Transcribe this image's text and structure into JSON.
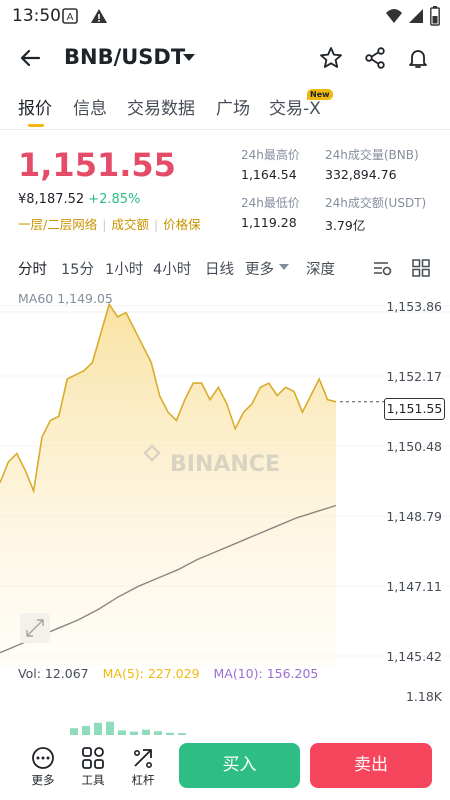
{
  "status_bar": {
    "time": "13:50",
    "battery": "battery"
  },
  "header": {
    "pair": "BNB/USDT"
  },
  "tabs": [
    {
      "label": "报价",
      "active": true
    },
    {
      "label": "信息"
    },
    {
      "label": "交易数据"
    },
    {
      "label": "广场"
    },
    {
      "label": "交易-X",
      "badge": "New"
    }
  ],
  "ticker": {
    "last_price": "1,151.55",
    "fiat_price": "¥8,187.52",
    "change_pct": "+2.85%",
    "tags": [
      "一层/二层网络",
      "成交额",
      "价格保"
    ],
    "stats": {
      "high_label": "24h最高价",
      "high": "1,164.54",
      "low_label": "24h最低价",
      "low": "1,119.28",
      "vol_bnb_label": "24h成交量(BNB)",
      "vol_bnb": "332,894.76",
      "vol_usdt_label": "24h成交额(USDT)",
      "vol_usdt": "3.79亿"
    }
  },
  "intervals": [
    "分时",
    "15分",
    "1小时",
    "4小时",
    "日线",
    "更多",
    "深度"
  ],
  "chart": {
    "ma60_label": "MA60 1,149.05",
    "watermark": "BINANCE",
    "current_price_tag": "1,151.55",
    "volume_axis_label": "1.18K"
  },
  "volume": {
    "vol": "Vol: 12.067",
    "ma5": "MA(5): 227.029",
    "ma10": "MA(10): 156.205"
  },
  "bottom_bar": {
    "more": "更多",
    "tools": "工具",
    "leverage": "杠杆",
    "buy": "买入",
    "sell": "卖出"
  },
  "colors": {
    "up": "#2ebd85",
    "down": "#f6465d",
    "accent": "#f0b90b",
    "price_red": "#e54c67"
  },
  "chart_data": {
    "type": "line",
    "y_ticks": [
      "1,153.86",
      "1,152.17",
      "1,150.48",
      "1,148.79",
      "1,147.11",
      "1,145.42"
    ],
    "ylim": [
      1145.42,
      1153.86
    ],
    "series": [
      {
        "values": [
          1149.6,
          1150.1,
          1150.3,
          1149.9,
          1149.4,
          1150.7,
          1151.1,
          1151.2,
          1152.1,
          1152.2,
          1152.3,
          1152.5,
          1153.2,
          1153.9,
          1153.6,
          1153.7,
          1153.3,
          1152.9,
          1152.5,
          1151.7,
          1151.3,
          1151.1,
          1151.6,
          1152.0,
          1152.0,
          1151.6,
          1151.9,
          1151.5,
          1150.9,
          1151.3,
          1151.5,
          1151.9,
          1152.0,
          1151.7,
          1151.9,
          1151.8,
          1151.3,
          1151.7,
          1152.1,
          1151.6,
          1151.55
        ]
      },
      {
        "name": "MA60",
        "values": [
          1145.5,
          1145.7,
          1145.9,
          1146.1,
          1146.3,
          1146.55,
          1146.85,
          1147.1,
          1147.3,
          1147.5,
          1147.75,
          1147.95,
          1148.15,
          1148.35,
          1148.55,
          1148.75,
          1148.9,
          1149.05
        ]
      }
    ],
    "volume_bars": [
      180,
      240,
      320,
      350,
      120,
      90,
      140,
      100,
      60,
      50
    ]
  }
}
